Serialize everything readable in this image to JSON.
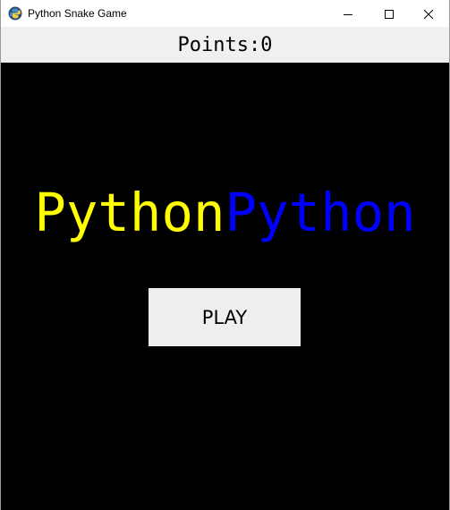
{
  "window": {
    "title": "Python Snake Game",
    "icon": "python-icon",
    "controls": {
      "minimize_icon": "minimize-icon",
      "maximize_icon": "maximize-icon",
      "close_icon": "close-icon"
    }
  },
  "scoreboard": {
    "label": "Points:0"
  },
  "game": {
    "title_part1": "Python",
    "title_part2": "Python",
    "play_label": "PLAY",
    "colors": {
      "background": "#000000",
      "title_part1": "#ffff00",
      "title_part2": "#0000ff",
      "button": "#eeeeee"
    }
  }
}
